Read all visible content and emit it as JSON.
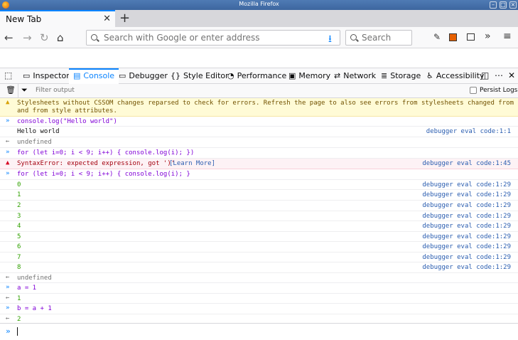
{
  "window": {
    "title": "Mozilla Firefox"
  },
  "tab": {
    "label": "New Tab"
  },
  "nav": {
    "url_placeholder": "Search with Google or enter address",
    "search_placeholder": "Search"
  },
  "devtools": {
    "tabs": [
      "Inspector",
      "Console",
      "Debugger",
      "Style Editor",
      "Performance",
      "Memory",
      "Network",
      "Storage",
      "Accessibility"
    ],
    "active_tab": "Console",
    "filter_placeholder": "Filter output",
    "persist_logs": "Persist Logs"
  },
  "console": {
    "warning": [
      "Stylesheets without CSSOM changes reparsed to check for errors. Refresh the page to also see errors from stylesheets changed from CSSOM",
      "and from style attributes."
    ],
    "input1": "console.log(\"Hello world\")",
    "output1": "Hello world",
    "source1": "debugger eval code:1:1",
    "result1": "undefined",
    "input2": "for (let i=0; i < 9; i++) { console.log(i); })",
    "error": "SyntaxError: expected expression, got ')'",
    "learn_more": "[Learn More]",
    "error_source": "debugger eval code:1:45",
    "input3": "for (let i=0; i < 9; i++) { console.log(i); }",
    "loop_values": [
      "0",
      "1",
      "2",
      "3",
      "4",
      "5",
      "6",
      "7",
      "8"
    ],
    "loop_source": "debugger eval code:1:29",
    "result3": "undefined",
    "input4": "a = 1",
    "result4": "1",
    "input5": "b = a + 1",
    "result5": "2"
  }
}
